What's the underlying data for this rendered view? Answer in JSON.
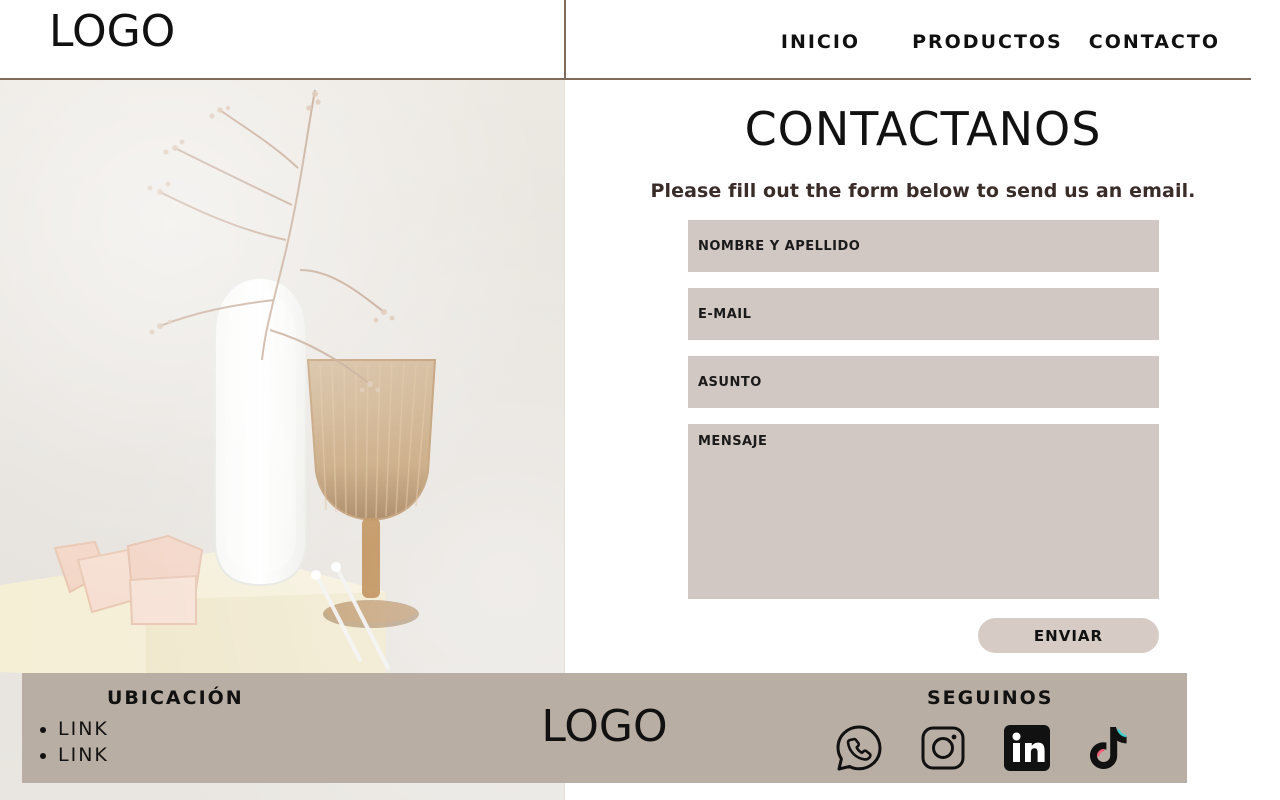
{
  "header": {
    "logo": "LOGO",
    "nav": [
      {
        "label": "INICIO"
      },
      {
        "label": "PRODUCTOS"
      },
      {
        "label": "CONTACTO"
      }
    ]
  },
  "main": {
    "title": "CONTACTANOS",
    "subtitle": "Please fill out the form below to send us an email.",
    "fields": {
      "name_placeholder": "NOMBRE Y APELLIDO",
      "email_placeholder": "E-MAIL",
      "subject_placeholder": "ASUNTO",
      "message_placeholder": "MENSAJE"
    },
    "send_label": "ENVIAR"
  },
  "footer": {
    "ubicacion_title": "UBICACIÓN",
    "links": [
      {
        "label": "LINK"
      },
      {
        "label": "LINK"
      }
    ],
    "logo": "LOGO",
    "seguinos_title": "SEGUINOS",
    "social": [
      {
        "name": "whatsapp-icon"
      },
      {
        "name": "instagram-icon"
      },
      {
        "name": "linkedin-icon"
      },
      {
        "name": "tiktok-icon"
      }
    ]
  },
  "colors": {
    "accent_line": "#7f6b57",
    "form_field_bg": "#d2c8c3",
    "footer_bg": "#b9aea3",
    "subtitle_text": "#3a2c28"
  }
}
